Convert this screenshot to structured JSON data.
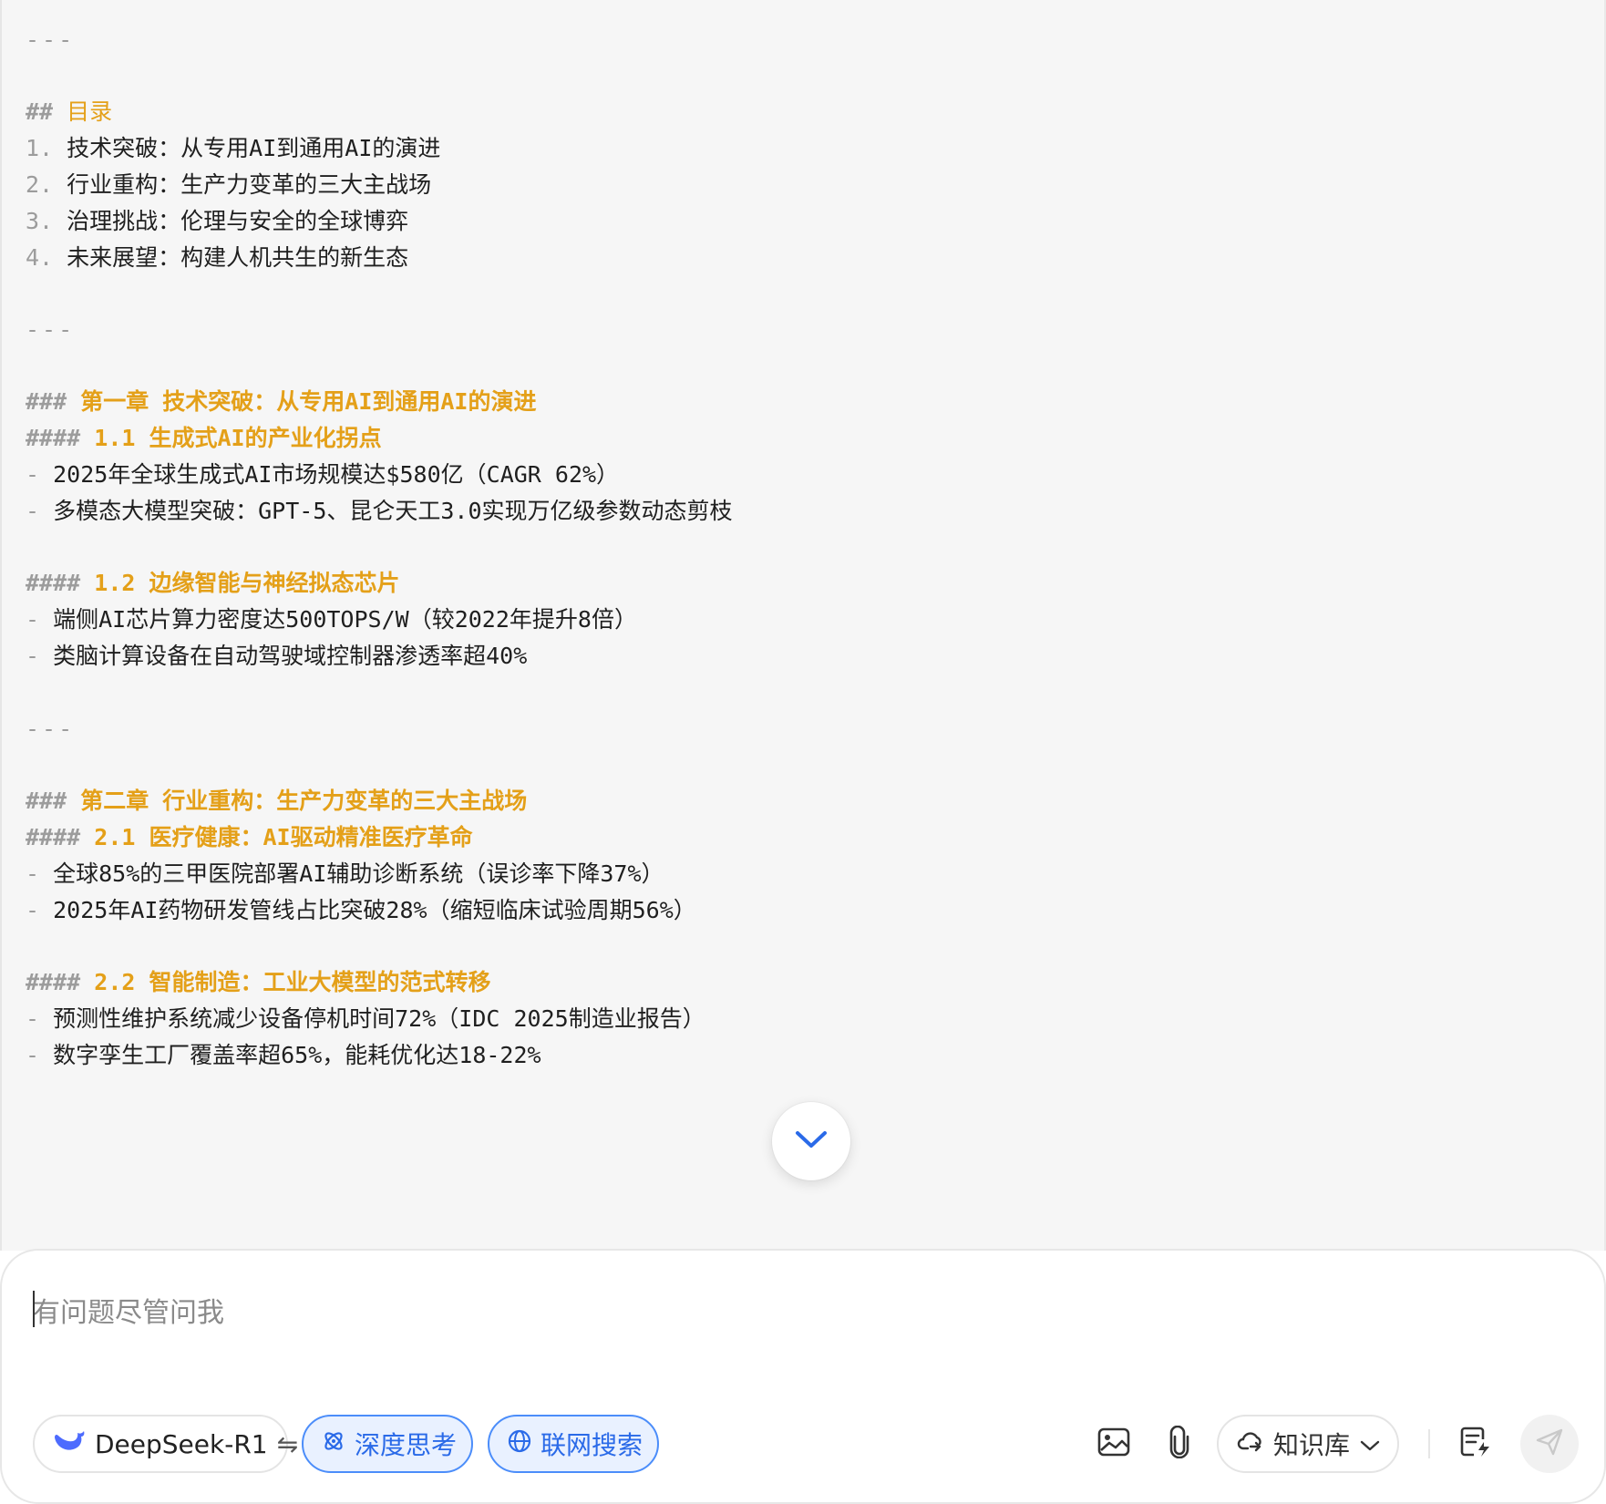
{
  "content": {
    "hr_top": "---",
    "toc_heading": {
      "marker": "##",
      "text": "目录"
    },
    "toc_items": [
      {
        "num": "1.",
        "text": "技术突破：从专用AI到通用AI的演进"
      },
      {
        "num": "2.",
        "text": "行业重构：生产力变革的三大主战场"
      },
      {
        "num": "3.",
        "text": "治理挑战：伦理与安全的全球博弈"
      },
      {
        "num": "4.",
        "text": "未来展望：构建人机共生的新生态"
      }
    ],
    "hr_2": "---",
    "ch1_heading": {
      "marker": "###",
      "text": "第一章 技术突破：从专用AI到通用AI的演进"
    },
    "s11_heading": {
      "marker": "####",
      "text": "1.1 生成式AI的产业化拐点"
    },
    "s11_bullets": [
      {
        "dash": "-",
        "text": "2025年全球生成式AI市场规模达$580亿（CAGR 62%）"
      },
      {
        "dash": "-",
        "text": "多模态大模型突破：GPT-5、昆仑天工3.0实现万亿级参数动态剪枝"
      }
    ],
    "s12_heading": {
      "marker": "####",
      "text": "1.2 边缘智能与神经拟态芯片"
    },
    "s12_bullets": [
      {
        "dash": "-",
        "text": "端侧AI芯片算力密度达500TOPS/W（较2022年提升8倍）"
      },
      {
        "dash": "-",
        "text": "类脑计算设备在自动驾驶域控制器渗透率超40%"
      }
    ],
    "hr_3": "---",
    "ch2_heading": {
      "marker": "###",
      "text": "第二章 行业重构：生产力变革的三大主战场"
    },
    "s21_heading": {
      "marker": "####",
      "text": "2.1 医疗健康：AI驱动精准医疗革命"
    },
    "s21_bullets": [
      {
        "dash": "-",
        "text": "全球85%的三甲医院部署AI辅助诊断系统（误诊率下降37%）"
      },
      {
        "dash": "-",
        "text": "2025年AI药物研发管线占比突破28%（缩短临床试验周期56%）"
      }
    ],
    "s22_heading": {
      "marker": "####",
      "text": "2.2 智能制造：工业大模型的范式转移"
    },
    "s22_bullets": [
      {
        "dash": "-",
        "text": "预测性维护系统减少设备停机时间72%（IDC 2025制造业报告）"
      },
      {
        "dash": "-",
        "text": "数字孪生工厂覆盖率超65%，能耗优化达18-22%"
      }
    ]
  },
  "composer": {
    "placeholder": "有问题尽管问我",
    "model_label": "DeepSeek-R1",
    "model_switch_glyph": "⇋",
    "deep_think_label": "深度思考",
    "web_search_label": "联网搜索",
    "knowledge_base_label": "知识库"
  },
  "icons": {
    "scroll_down": "chevron-down-icon",
    "model": "deepseek-whale-icon",
    "deep_think": "atom-icon",
    "web_search": "globe-icon",
    "image": "image-icon",
    "attach": "paperclip-icon",
    "knowledge_base": "cloud-link-icon",
    "kb_dropdown": "chevron-down-icon",
    "notes": "quick-note-icon",
    "send": "send-icon"
  },
  "colors": {
    "heading": "#e4a019",
    "markdown_marker": "#9c9c9c",
    "accent_blue": "#2a6ae8",
    "active_pill_bg": "#e9f1ff"
  }
}
